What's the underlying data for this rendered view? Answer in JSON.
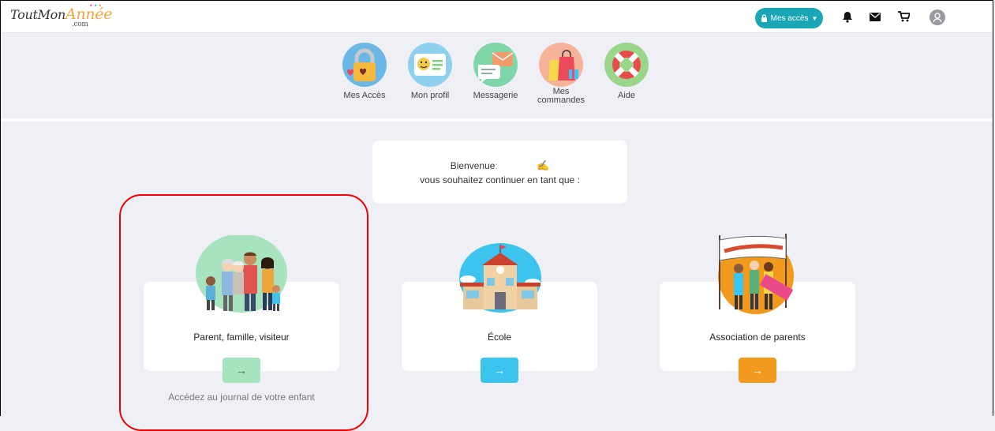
{
  "brand": {
    "logo_main": "ToutMon",
    "logo_accent": "Année",
    "logo_suffix": ".com"
  },
  "topbar": {
    "access_button_label": "Mes accès",
    "icons": [
      "lock-icon",
      "bell-icon",
      "envelope-icon",
      "cart-icon",
      "user-avatar-icon"
    ]
  },
  "nav": {
    "items": [
      {
        "label": "Mes Accès",
        "icon": "lock-hearts-icon"
      },
      {
        "label": "Mon profil",
        "icon": "profile-card-icon"
      },
      {
        "label": "Messagerie",
        "icon": "chat-envelope-icon"
      },
      {
        "label": "Mes commandes",
        "icon": "shopping-bags-icon"
      },
      {
        "label": "Aide",
        "icon": "lifebuoy-icon"
      }
    ]
  },
  "welcome": {
    "line1": "Bienvenue",
    "line2": "vous souhaitez continuer en tant que :"
  },
  "cards": [
    {
      "title": "Parent, famille, visiteur",
      "button": "→",
      "color": "#a8e3bf",
      "description": "Accédez au journal de votre enfant"
    },
    {
      "title": "École",
      "button": "→",
      "color": "#3cc3ee"
    },
    {
      "title": "Association de parents",
      "button": "→",
      "color": "#f29a1e"
    }
  ],
  "colors": {
    "teal": "#1aa7b5",
    "background": "#eef0f6",
    "highlight": "#e00000"
  }
}
